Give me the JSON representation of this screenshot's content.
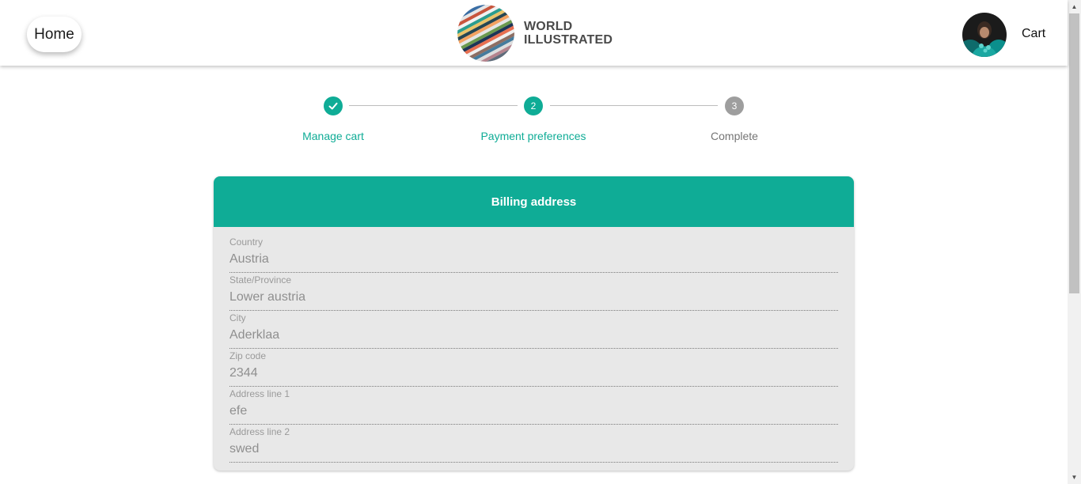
{
  "header": {
    "home_label": "Home",
    "logo": {
      "line1": "WORLD",
      "line2": "ILLUSTRATED",
      "icon": "striped-globe-logo"
    },
    "avatar_icon": "user-avatar",
    "cart_label": "Cart"
  },
  "stepper": {
    "steps": [
      {
        "number": "1",
        "label": "Manage cart",
        "state": "completed",
        "icon": "check-icon"
      },
      {
        "number": "2",
        "label": "Payment preferences",
        "state": "active"
      },
      {
        "number": "3",
        "label": "Complete",
        "state": "upcoming"
      }
    ]
  },
  "billing": {
    "title": "Billing address",
    "fields": [
      {
        "label": "Country",
        "value": "Austria"
      },
      {
        "label": "State/Province",
        "value": "Lower austria"
      },
      {
        "label": "City",
        "value": "Aderklaa"
      },
      {
        "label": "Zip code",
        "value": "2344"
      },
      {
        "label": "Address line 1",
        "value": "efe"
      },
      {
        "label": "Address line 2",
        "value": "swed"
      }
    ]
  },
  "colors": {
    "accent": "#0fac96",
    "step_inactive": "#9e9e9e",
    "card_background": "#e8e8e8"
  }
}
